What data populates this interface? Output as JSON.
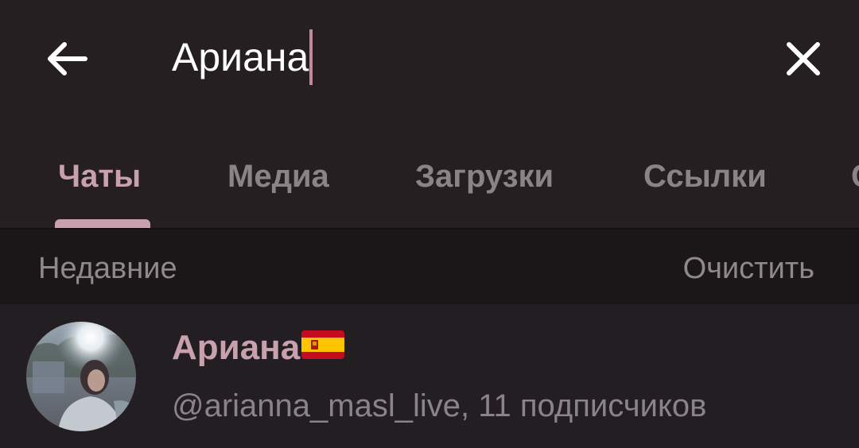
{
  "search": {
    "query": "Ариана"
  },
  "tabs": [
    {
      "label": "Чаты",
      "active": true
    },
    {
      "label": "Медиа",
      "active": false
    },
    {
      "label": "Загрузки",
      "active": false
    },
    {
      "label": "Ссылки",
      "active": false
    },
    {
      "label": "С",
      "active": false
    }
  ],
  "recent": {
    "title": "Недавние",
    "clear_label": "Очистить"
  },
  "results": [
    {
      "name": "Ариана",
      "flag_icon": "spain-flag-icon",
      "subtitle": "@arianna_masl_live, 11 подписчиков"
    }
  ],
  "colors": {
    "accent": "#c9a0ae",
    "background": "#231e21",
    "header_background": "#1b1719",
    "muted_text": "#8a8387"
  }
}
